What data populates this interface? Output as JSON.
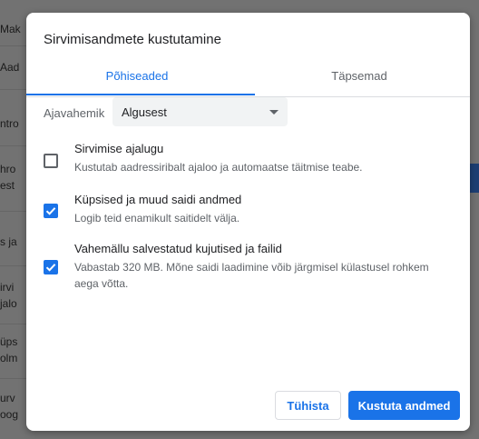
{
  "background": {
    "fragments": [
      "Mak",
      "Aad",
      "ntro",
      "hro",
      "est",
      "s ja",
      "irvi",
      "jalo",
      "üps",
      "olm",
      "urv",
      "oog"
    ]
  },
  "dialog": {
    "title": "Sirvimisandmete kustutamine",
    "tabs": [
      {
        "label": "Põhiseaded",
        "active": true
      },
      {
        "label": "Täpsemad",
        "active": false
      }
    ],
    "time_range": {
      "label": "Ajavahemik",
      "selected": "Algusest"
    },
    "options": [
      {
        "title": "Sirvimise ajalugu",
        "description": "Kustutab aadressiribalt ajaloo ja automaatse täitmise teabe.",
        "checked": false
      },
      {
        "title": "Küpsised ja muud saidi andmed",
        "description": "Logib teid enamikult saitidelt välja.",
        "checked": true
      },
      {
        "title": "Vahemällu salvestatud kujutised ja failid",
        "description": "Vabastab 320 MB. Mõne saidi laadimine võib järgmisel külastusel rohkem aega võtta.",
        "checked": true
      }
    ],
    "buttons": {
      "cancel": "Tühista",
      "clear": "Kustuta andmed"
    }
  },
  "colors": {
    "accent": "#1a73e8",
    "overlay": "#727272"
  },
  "icons": {
    "dropdown": "caret-down-icon",
    "check": "checkmark-icon"
  }
}
